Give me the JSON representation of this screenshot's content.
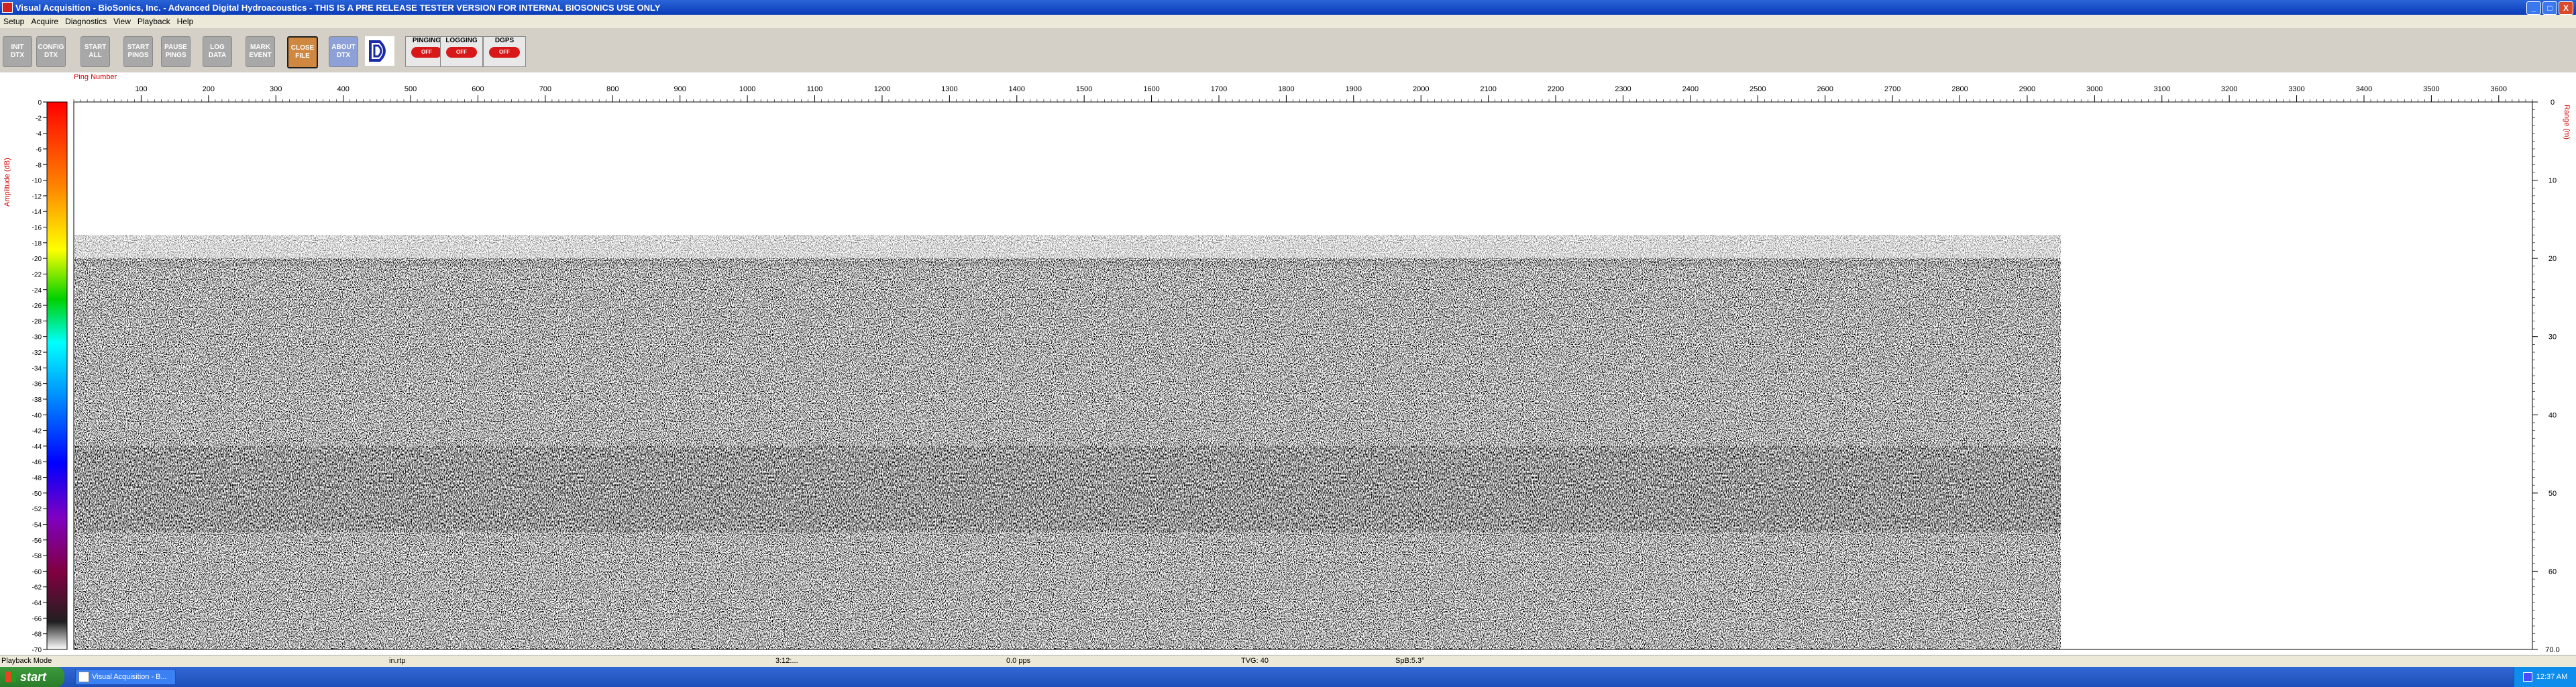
{
  "window": {
    "title": "Visual Acquisition  -  BioSonics, Inc.  -  Advanced Digital Hydroacoustics  -  THIS IS A PRE RELEASE TESTER VERSION FOR INTERNAL BIOSONICS USE ONLY",
    "minimize": "_",
    "maximize": "□",
    "close": "X"
  },
  "menu": [
    "Setup",
    "Acquire",
    "Diagnostics",
    "View",
    "Playback",
    "Help"
  ],
  "toolbar": {
    "buttons": [
      {
        "label": "INIT\nDTX",
        "style": "gray"
      },
      {
        "label": "CONFIG\nDTX",
        "style": "gray"
      },
      {
        "label": "START\nALL",
        "style": "gray"
      },
      {
        "label": "START\nPINGS",
        "style": "gray"
      },
      {
        "label": "PAUSE\nPINGS",
        "style": "gray"
      },
      {
        "label": "LOG\nDATA",
        "style": "gray"
      },
      {
        "label": "MARK\nEVENT",
        "style": "gray"
      },
      {
        "label": "CLOSE\nFILE",
        "style": "orange"
      },
      {
        "label": "ABOUT\nDTX",
        "style": "blue"
      }
    ],
    "status": [
      {
        "label": "PINGING",
        "pill": "OFF"
      },
      {
        "label": "LOGGING",
        "pill": "OFF"
      },
      {
        "label": "DGPS",
        "pill": "OFF"
      }
    ]
  },
  "colorbar": {
    "title": "Amplitude (dB)",
    "ticks": [
      "0",
      "-2",
      "-4",
      "-6",
      "-8",
      "-10",
      "-12",
      "-14",
      "-16",
      "-18",
      "-20",
      "-22",
      "-24",
      "-26",
      "-28",
      "-30",
      "-32",
      "-34",
      "-36",
      "-38",
      "-40",
      "-42",
      "-44",
      "-46",
      "-48",
      "-50",
      "-52",
      "-54",
      "-56",
      "-58",
      "-60",
      "-62",
      "-64",
      "-66",
      "-68",
      "-70"
    ]
  },
  "chart_data": {
    "type": "heatmap",
    "xlabel": "Ping Number",
    "ylabel": "Range (m)",
    "xlim": [
      0,
      3650
    ],
    "ylim": [
      0,
      70
    ],
    "xticks": [
      "100",
      "200",
      "300",
      "400",
      "500",
      "600",
      "700",
      "800",
      "900",
      "1000",
      "1100",
      "1200",
      "1300",
      "1400",
      "1500",
      "1600",
      "1700",
      "1800",
      "1900",
      "2000",
      "2100",
      "2200",
      "2300",
      "2400",
      "2500",
      "2600",
      "2700",
      "2800",
      "2900",
      "3000",
      "3100",
      "3200",
      "3300",
      "3400",
      "3500",
      "3600"
    ],
    "yticks": [
      "0",
      "10",
      "20",
      "30",
      "40",
      "50",
      "60",
      "70.0"
    ],
    "data_extent_pings": 2950,
    "bands": [
      {
        "range_start": 20,
        "range_end": 44,
        "amplitude_db": -60
      },
      {
        "range_start": 44,
        "range_end": 46,
        "amplitude_db": -30
      },
      {
        "range_start": 46,
        "range_end": 51,
        "amplitude_db": -45
      },
      {
        "range_start": 51,
        "range_end": 55,
        "amplitude_db": -34
      },
      {
        "range_start": 55,
        "range_end": 70,
        "amplitude_db": -62
      }
    ]
  },
  "statusbar": {
    "mode": "Playback Mode",
    "file": "in.rtp",
    "time": "3:12:...",
    "rate": "0.0 pps",
    "tvg": "TVG: 40",
    "spb": "SpB:5.3°"
  },
  "taskbar": {
    "start": "start",
    "task": "Visual Acquisition - B...",
    "clock": "12:37 AM"
  }
}
